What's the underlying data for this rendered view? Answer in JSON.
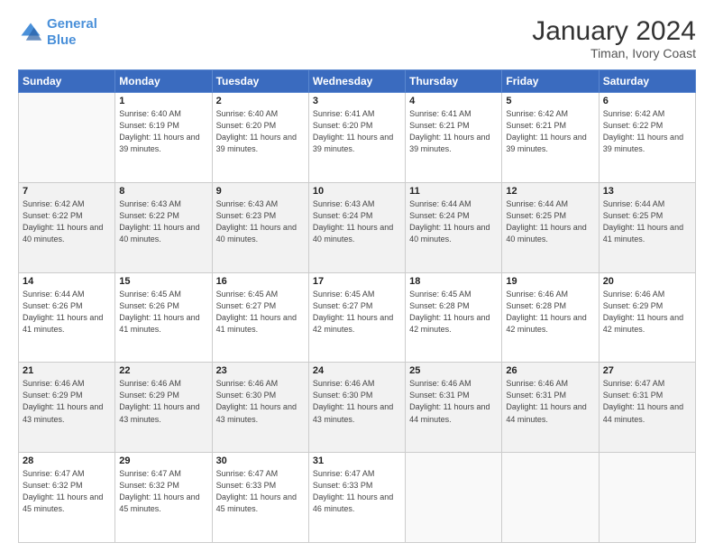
{
  "header": {
    "logo_line1": "General",
    "logo_line2": "Blue",
    "title": "January 2024",
    "subtitle": "Timan, Ivory Coast"
  },
  "columns": [
    "Sunday",
    "Monday",
    "Tuesday",
    "Wednesday",
    "Thursday",
    "Friday",
    "Saturday"
  ],
  "weeks": [
    [
      {
        "day": "",
        "detail": ""
      },
      {
        "day": "1",
        "detail": "Sunrise: 6:40 AM\nSunset: 6:19 PM\nDaylight: 11 hours\nand 39 minutes."
      },
      {
        "day": "2",
        "detail": "Sunrise: 6:40 AM\nSunset: 6:20 PM\nDaylight: 11 hours\nand 39 minutes."
      },
      {
        "day": "3",
        "detail": "Sunrise: 6:41 AM\nSunset: 6:20 PM\nDaylight: 11 hours\nand 39 minutes."
      },
      {
        "day": "4",
        "detail": "Sunrise: 6:41 AM\nSunset: 6:21 PM\nDaylight: 11 hours\nand 39 minutes."
      },
      {
        "day": "5",
        "detail": "Sunrise: 6:42 AM\nSunset: 6:21 PM\nDaylight: 11 hours\nand 39 minutes."
      },
      {
        "day": "6",
        "detail": "Sunrise: 6:42 AM\nSunset: 6:22 PM\nDaylight: 11 hours\nand 39 minutes."
      }
    ],
    [
      {
        "day": "7",
        "detail": "Sunrise: 6:42 AM\nSunset: 6:22 PM\nDaylight: 11 hours\nand 40 minutes."
      },
      {
        "day": "8",
        "detail": "Sunrise: 6:43 AM\nSunset: 6:22 PM\nDaylight: 11 hours\nand 40 minutes."
      },
      {
        "day": "9",
        "detail": "Sunrise: 6:43 AM\nSunset: 6:23 PM\nDaylight: 11 hours\nand 40 minutes."
      },
      {
        "day": "10",
        "detail": "Sunrise: 6:43 AM\nSunset: 6:24 PM\nDaylight: 11 hours\nand 40 minutes."
      },
      {
        "day": "11",
        "detail": "Sunrise: 6:44 AM\nSunset: 6:24 PM\nDaylight: 11 hours\nand 40 minutes."
      },
      {
        "day": "12",
        "detail": "Sunrise: 6:44 AM\nSunset: 6:25 PM\nDaylight: 11 hours\nand 40 minutes."
      },
      {
        "day": "13",
        "detail": "Sunrise: 6:44 AM\nSunset: 6:25 PM\nDaylight: 11 hours\nand 41 minutes."
      }
    ],
    [
      {
        "day": "14",
        "detail": "Sunrise: 6:44 AM\nSunset: 6:26 PM\nDaylight: 11 hours\nand 41 minutes."
      },
      {
        "day": "15",
        "detail": "Sunrise: 6:45 AM\nSunset: 6:26 PM\nDaylight: 11 hours\nand 41 minutes."
      },
      {
        "day": "16",
        "detail": "Sunrise: 6:45 AM\nSunset: 6:27 PM\nDaylight: 11 hours\nand 41 minutes."
      },
      {
        "day": "17",
        "detail": "Sunrise: 6:45 AM\nSunset: 6:27 PM\nDaylight: 11 hours\nand 42 minutes."
      },
      {
        "day": "18",
        "detail": "Sunrise: 6:45 AM\nSunset: 6:28 PM\nDaylight: 11 hours\nand 42 minutes."
      },
      {
        "day": "19",
        "detail": "Sunrise: 6:46 AM\nSunset: 6:28 PM\nDaylight: 11 hours\nand 42 minutes."
      },
      {
        "day": "20",
        "detail": "Sunrise: 6:46 AM\nSunset: 6:29 PM\nDaylight: 11 hours\nand 42 minutes."
      }
    ],
    [
      {
        "day": "21",
        "detail": "Sunrise: 6:46 AM\nSunset: 6:29 PM\nDaylight: 11 hours\nand 43 minutes."
      },
      {
        "day": "22",
        "detail": "Sunrise: 6:46 AM\nSunset: 6:29 PM\nDaylight: 11 hours\nand 43 minutes."
      },
      {
        "day": "23",
        "detail": "Sunrise: 6:46 AM\nSunset: 6:30 PM\nDaylight: 11 hours\nand 43 minutes."
      },
      {
        "day": "24",
        "detail": "Sunrise: 6:46 AM\nSunset: 6:30 PM\nDaylight: 11 hours\nand 43 minutes."
      },
      {
        "day": "25",
        "detail": "Sunrise: 6:46 AM\nSunset: 6:31 PM\nDaylight: 11 hours\nand 44 minutes."
      },
      {
        "day": "26",
        "detail": "Sunrise: 6:46 AM\nSunset: 6:31 PM\nDaylight: 11 hours\nand 44 minutes."
      },
      {
        "day": "27",
        "detail": "Sunrise: 6:47 AM\nSunset: 6:31 PM\nDaylight: 11 hours\nand 44 minutes."
      }
    ],
    [
      {
        "day": "28",
        "detail": "Sunrise: 6:47 AM\nSunset: 6:32 PM\nDaylight: 11 hours\nand 45 minutes."
      },
      {
        "day": "29",
        "detail": "Sunrise: 6:47 AM\nSunset: 6:32 PM\nDaylight: 11 hours\nand 45 minutes."
      },
      {
        "day": "30",
        "detail": "Sunrise: 6:47 AM\nSunset: 6:33 PM\nDaylight: 11 hours\nand 45 minutes."
      },
      {
        "day": "31",
        "detail": "Sunrise: 6:47 AM\nSunset: 6:33 PM\nDaylight: 11 hours\nand 46 minutes."
      },
      {
        "day": "",
        "detail": ""
      },
      {
        "day": "",
        "detail": ""
      },
      {
        "day": "",
        "detail": ""
      }
    ]
  ]
}
